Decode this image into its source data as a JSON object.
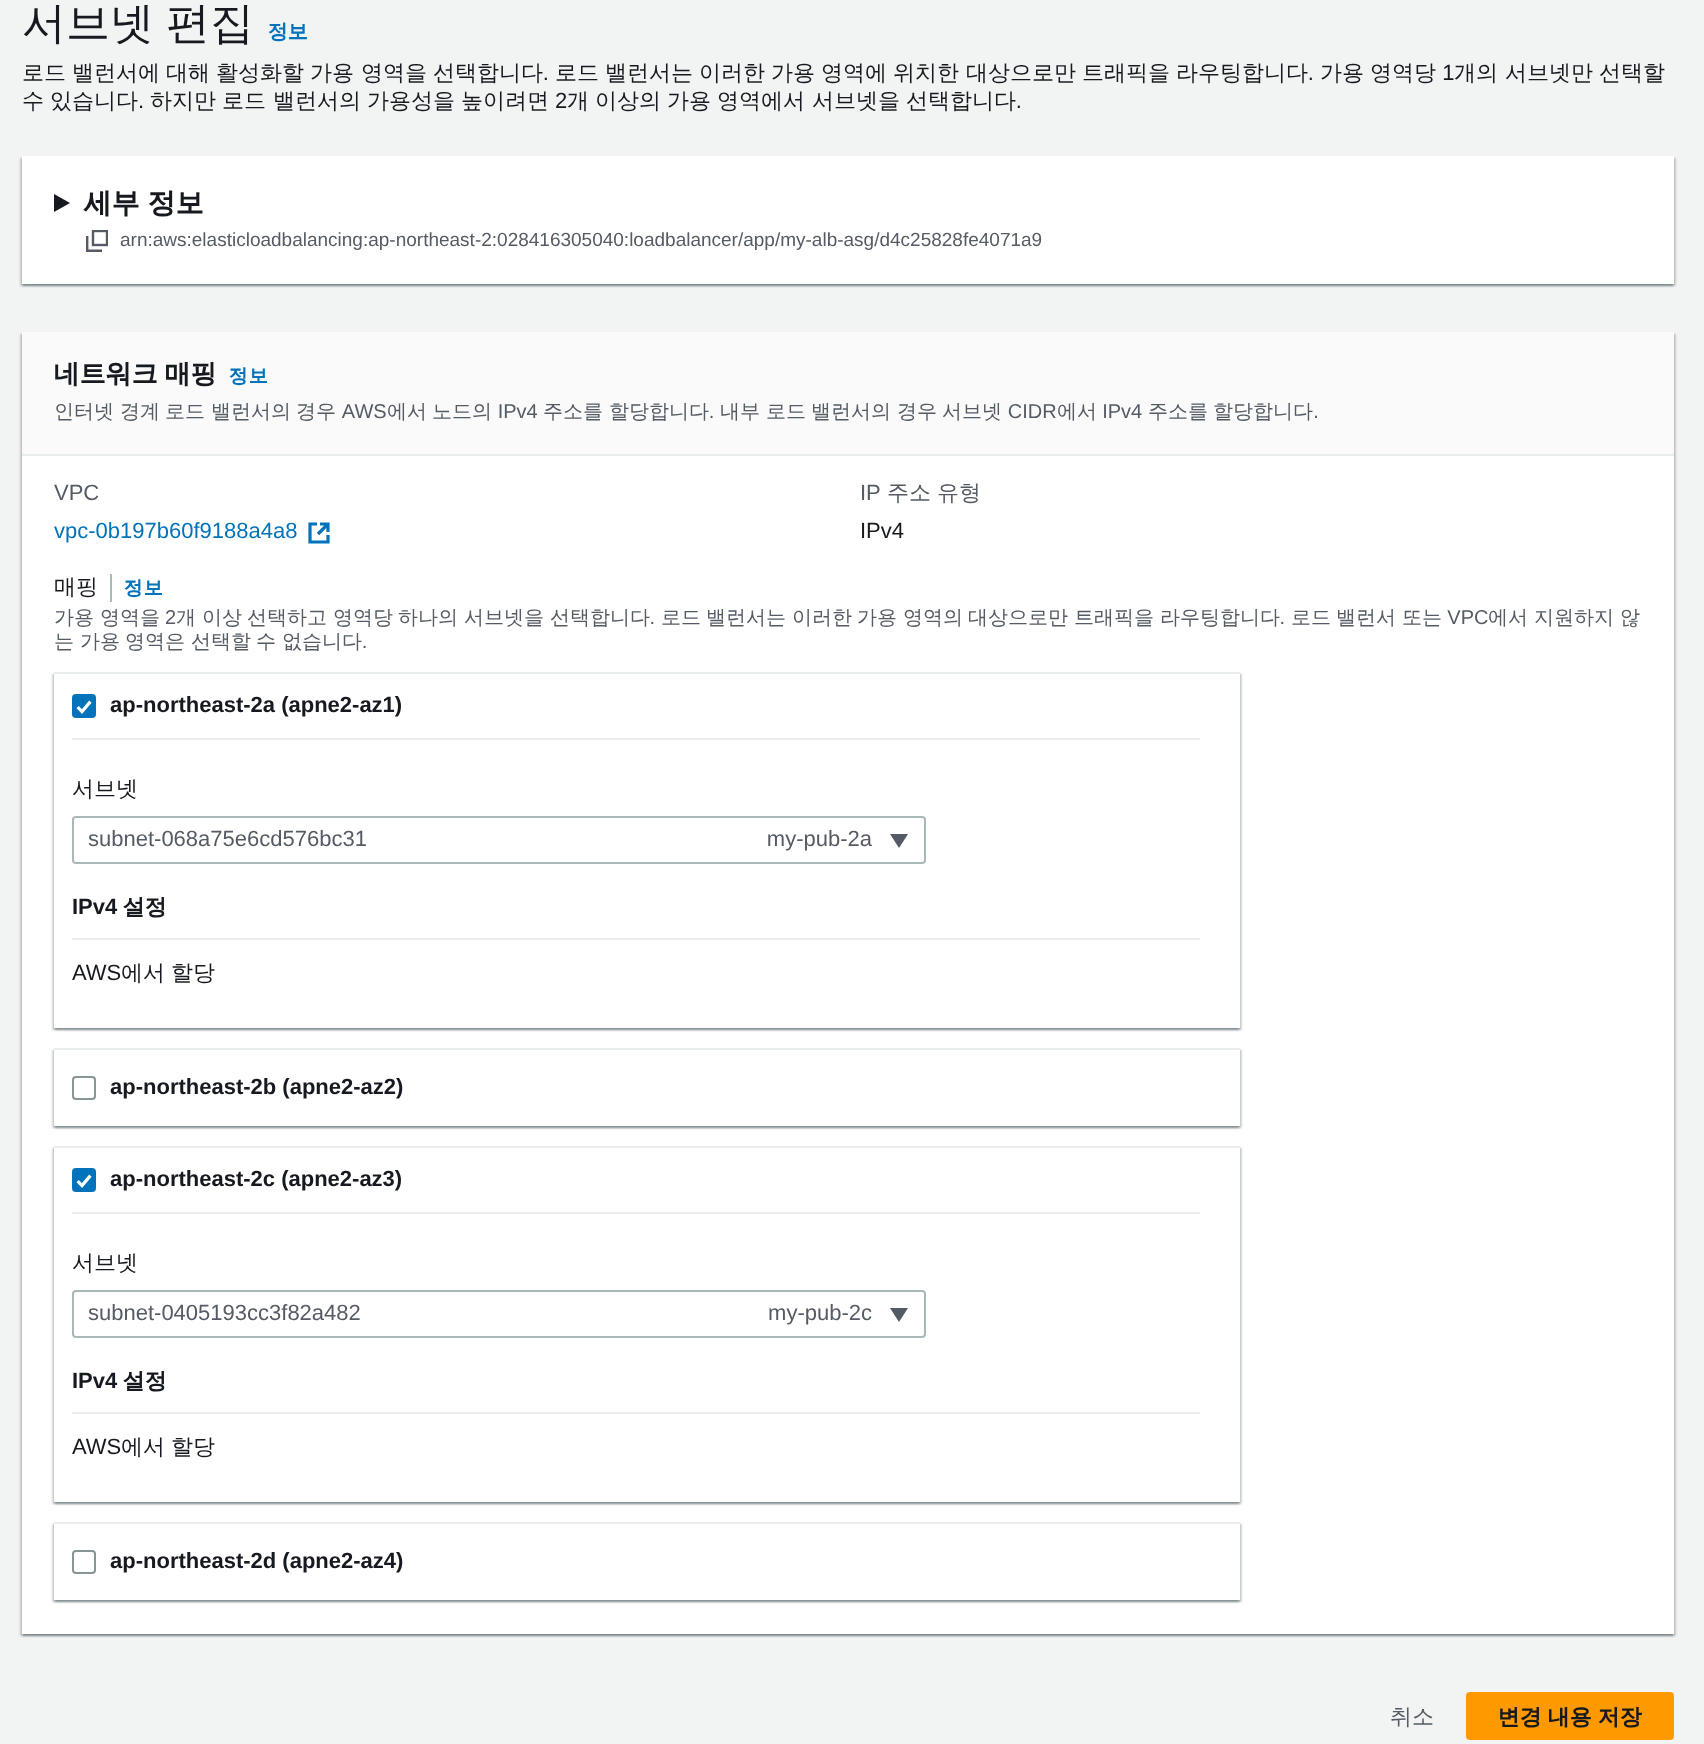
{
  "page": {
    "title": "서브넷 편집",
    "info_link": "정보",
    "description": "로드 밸런서에 대해 활성화할 가용 영역을 선택합니다. 로드 밸런서는 이러한 가용 영역에 위치한 대상으로만 트래픽을 라우팅합니다. 가용 영역당 1개의 서브넷만 선택할 수 있습니다. 하지만 로드 밸런서의 가용성을 높이려면 2개 이상의 가용 영역에서 서브넷을 선택합니다."
  },
  "details_panel": {
    "title": "세부 정보",
    "expanded": false,
    "arn": "arn:aws:elasticloadbalancing:ap-northeast-2:028416305040:loadbalancer/app/my-alb-asg/d4c25828fe4071a9"
  },
  "network_mapping": {
    "title": "네트워크 매핑",
    "info_link": "정보",
    "description": "인터넷 경계 로드 밸런서의 경우 AWS에서 노드의 IPv4 주소를 할당합니다. 내부 로드 밸런서의 경우 서브넷 CIDR에서 IPv4 주소를 할당합니다.",
    "vpc": {
      "label": "VPC",
      "value": "vpc-0b197b60f9188a4a8"
    },
    "ip_address_type": {
      "label": "IP 주소 유형",
      "value": "IPv4"
    },
    "mappings": {
      "label": "매핑",
      "info_link": "정보",
      "description": "가용 영역을 2개 이상 선택하고 영역당 하나의 서브넷을 선택합니다. 로드 밸런서는 이러한 가용 영역의 대상으로만 트래픽을 라우팅합니다. 로드 밸런서 또는 VPC에서 지원하지 않는 가용 영역은 선택할 수 없습니다."
    },
    "zones": [
      {
        "name": "ap-northeast-2a (apne2-az1)",
        "checked": true,
        "subnet_label": "서브넷",
        "subnet_id": "subnet-068a75e6cd576bc31",
        "subnet_name": "my-pub-2a",
        "ipv4_label": "IPv4 설정",
        "ipv4_value": "AWS에서 할당"
      },
      {
        "name": "ap-northeast-2b (apne2-az2)",
        "checked": false
      },
      {
        "name": "ap-northeast-2c (apne2-az3)",
        "checked": true,
        "subnet_label": "서브넷",
        "subnet_id": "subnet-0405193cc3f82a482",
        "subnet_name": "my-pub-2c",
        "ipv4_label": "IPv4 설정",
        "ipv4_value": "AWS에서 할당"
      },
      {
        "name": "ap-northeast-2d (apne2-az4)",
        "checked": false
      }
    ]
  },
  "actions": {
    "cancel": "취소",
    "save": "변경 내용 저장"
  }
}
